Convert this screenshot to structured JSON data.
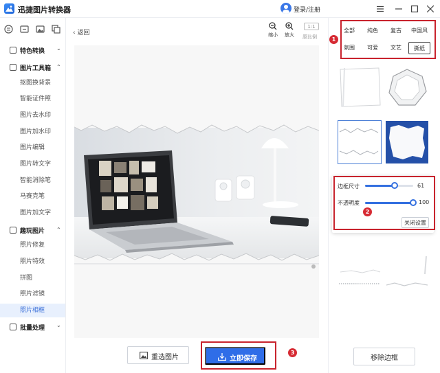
{
  "app": {
    "title": "迅捷图片转换器",
    "login": "登录/注册"
  },
  "sidebar": {
    "categories": [
      {
        "label": "特色转换",
        "expanded": false,
        "items": []
      },
      {
        "label": "图片工具箱",
        "expanded": true,
        "items": [
          "抠图换背景",
          "智能证件照",
          "图片去水印",
          "图片加水印",
          "图片编辑",
          "图片转文字",
          "智能消除笔",
          "马赛克笔",
          "图片加文字"
        ]
      },
      {
        "label": "趣玩图片",
        "expanded": true,
        "items": [
          "照片修复",
          "照片特效",
          "拼图",
          "照片滤镜",
          "照片相框"
        ]
      },
      {
        "label": "批量处理",
        "expanded": false,
        "items": []
      }
    ],
    "active_item": "照片相框"
  },
  "toolbar": {
    "back": "返回",
    "zoom_out": "缩小",
    "zoom_in": "放大",
    "ratio": "1:1",
    "ratio_label": "原比例"
  },
  "actions": {
    "reselect": "重选图片",
    "save": "立即保存"
  },
  "frame_panel": {
    "tags": [
      "全部",
      "纯色",
      "复古",
      "中国风",
      "氛围",
      "可爱",
      "文艺",
      "撕纸"
    ],
    "selected_tag": "撕纸",
    "settings": {
      "border_size_label": "边框尺寸",
      "border_size_value": 61,
      "border_size_max": 100,
      "opacity_label": "不透明度",
      "opacity_value": 100,
      "opacity_max": 100,
      "close_settings": "关闭设置"
    },
    "remove_border": "移除边框"
  },
  "annotations": [
    "1",
    "2",
    "3"
  ],
  "colors": {
    "accent": "#2f6de8",
    "annotation_red": "#c8232d"
  }
}
